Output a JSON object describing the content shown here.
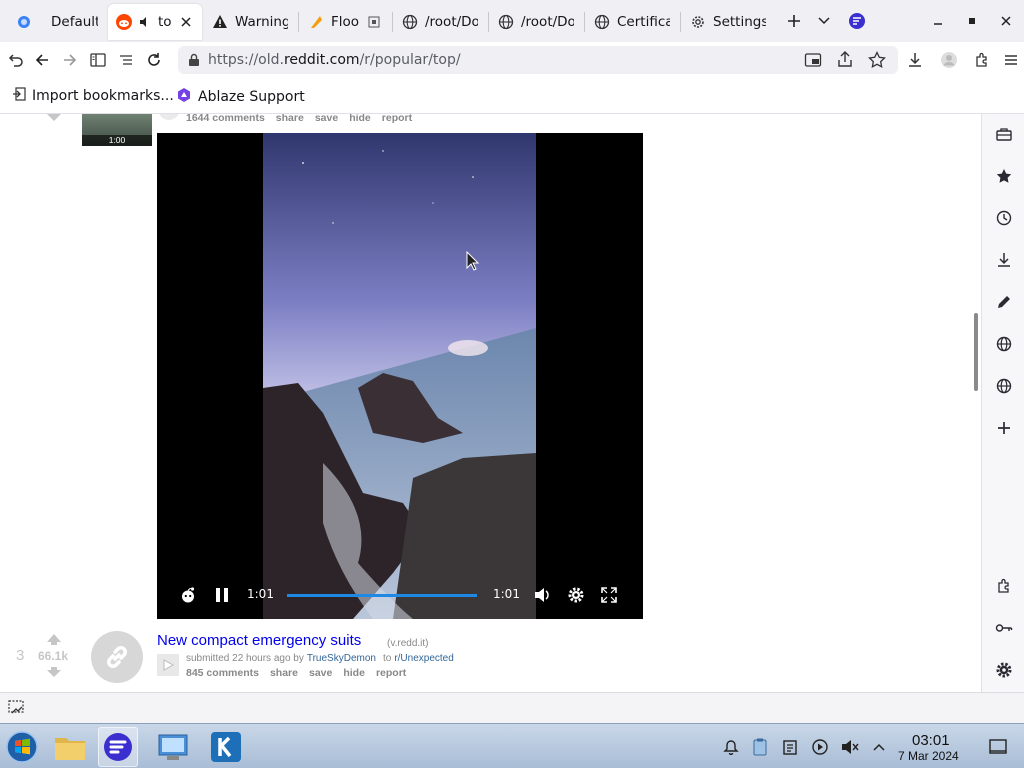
{
  "tabs": [
    {
      "label": "Default",
      "icon": "firefox-profile-icon",
      "active": false
    },
    {
      "label": "top",
      "icon": "reddit-icon",
      "active": true,
      "audio": true
    },
    {
      "label": "Warning:",
      "icon": "warning-icon"
    },
    {
      "label": "Floorp",
      "icon": "floorp-icon"
    },
    {
      "label": "/root/Dow",
      "icon": "globe-icon"
    },
    {
      "label": "/root/Dow",
      "icon": "globe-icon"
    },
    {
      "label": "Certificat",
      "icon": "globe-icon"
    },
    {
      "label": "Settings",
      "icon": "gear-icon"
    }
  ],
  "url": {
    "prefix": "https://old.",
    "host": "reddit.com",
    "path": "/r/popular/top/"
  },
  "bookmarks": {
    "import": "Import bookmarks...",
    "ablaze": "Ablaze Support"
  },
  "post_above": {
    "thumb_duration": "1:00",
    "actions": [
      "1644 comments",
      "share",
      "save",
      "hide",
      "report"
    ]
  },
  "video": {
    "time_current": "1:01",
    "time_total": "1:01",
    "progress": 1.0
  },
  "post3": {
    "rank": "3",
    "score": "66.1k",
    "title": "New compact emergency suits",
    "domain": "(v.redd.it)",
    "submitted": "submitted 22 hours ago by",
    "author": "TrueSkyDemon",
    "to": "to",
    "subreddit": "r/Unexpected",
    "actions": [
      "845 comments",
      "share",
      "save",
      "hide",
      "report"
    ]
  },
  "clock": {
    "time": "03:01",
    "date": "7 Mar 2024"
  },
  "colors": {
    "link": "#0000ee",
    "subreddit": "#336699",
    "accent": "#7542e5"
  }
}
